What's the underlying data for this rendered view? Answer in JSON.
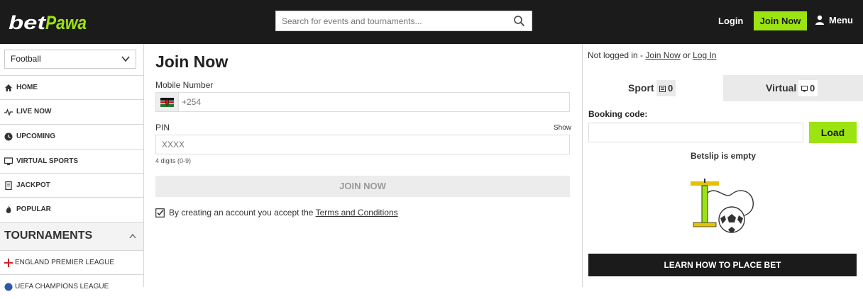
{
  "header": {
    "logo_text": "betPawa",
    "search_placeholder": "Search for events and tournaments...",
    "login_label": "Login",
    "join_label": "Join Now",
    "menu_label": "Menu",
    "accent_color": "#9ce312",
    "bar_color": "#1b1b1b"
  },
  "sidebar": {
    "sport_select_value": "Football",
    "items": [
      {
        "label": "Home",
        "icon": "home-icon"
      },
      {
        "label": "Live Now",
        "icon": "pulse-icon"
      },
      {
        "label": "Upcoming",
        "icon": "clock-icon"
      },
      {
        "label": "Virtual Sports",
        "icon": "monitor-icon"
      },
      {
        "label": "Jackpot",
        "icon": "ticket-icon"
      },
      {
        "label": "Popular",
        "icon": "flame-icon"
      }
    ],
    "tournaments_heading": "Tournaments",
    "tournaments": [
      {
        "label": "England Premier League",
        "icon": "england-flag-icon"
      },
      {
        "label": "UEFA Champions League",
        "icon": "uefa-icon"
      }
    ]
  },
  "main": {
    "title": "Join Now",
    "mobile_label": "Mobile Number",
    "mobile_prefix": "+254",
    "pin_label": "PIN",
    "show_label": "Show",
    "pin_placeholder": "XXXX",
    "pin_hint": "4 digits (0-9)",
    "join_button": "Join Now",
    "terms_prefix": "By creating an account you accept the ",
    "terms_link": "Terms and Conditions"
  },
  "betslip": {
    "not_logged_prefix": "Not logged in - ",
    "join_link": "Join Now",
    "or_text": " or ",
    "login_link": "Log In",
    "tab_sport": "Sport",
    "tab_sport_count": "0",
    "tab_virtual": "Virtual",
    "tab_virtual_count": "0",
    "booking_label": "Booking code:",
    "load_button": "Load",
    "empty_text": "Betslip is empty",
    "learn_button": "Learn how to place bet"
  }
}
